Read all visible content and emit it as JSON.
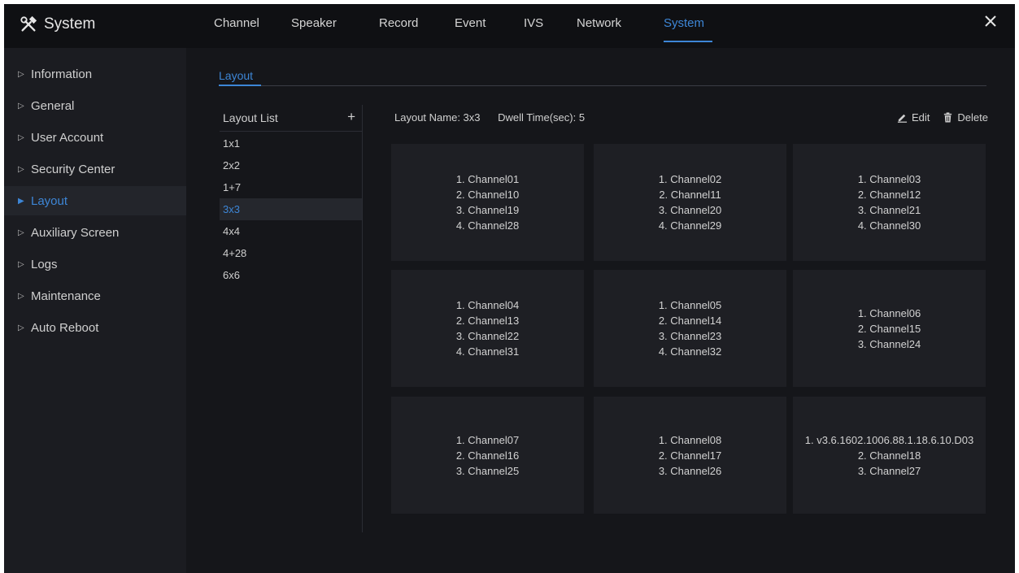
{
  "app": {
    "title": "System"
  },
  "top_tabs": [
    {
      "label": "Channel"
    },
    {
      "label": "Speaker"
    },
    {
      "label": "Record"
    },
    {
      "label": "Event"
    },
    {
      "label": "IVS"
    },
    {
      "label": "Network"
    },
    {
      "label": "System"
    }
  ],
  "active_tab": "System",
  "sidebar": {
    "items": [
      {
        "label": "Information"
      },
      {
        "label": "General"
      },
      {
        "label": "User Account"
      },
      {
        "label": "Security Center"
      },
      {
        "label": "Layout"
      },
      {
        "label": "Auxiliary Screen"
      },
      {
        "label": "Logs"
      },
      {
        "label": "Maintenance"
      },
      {
        "label": "Auto Reboot"
      }
    ],
    "active": "Layout"
  },
  "subtab": {
    "label": "Layout"
  },
  "layout_list": {
    "header": "Layout List",
    "add_label": "+",
    "items": [
      {
        "label": "1x1"
      },
      {
        "label": "2x2"
      },
      {
        "label": "1+7"
      },
      {
        "label": "3x3"
      },
      {
        "label": "4x4"
      },
      {
        "label": "4+28"
      },
      {
        "label": "6x6"
      }
    ],
    "selected": "3x3"
  },
  "detail": {
    "layout_name": "Layout Name: 3x3",
    "dwell_time": "Dwell Time(sec): 5",
    "edit_label": "Edit",
    "delete_label": "Delete"
  },
  "cells": [
    {
      "lines": [
        "1. Channel01",
        "2. Channel10",
        "3. Channel19",
        "4. Channel28"
      ]
    },
    {
      "lines": [
        "1. Channel02",
        "2. Channel11",
        "3. Channel20",
        "4. Channel29"
      ]
    },
    {
      "lines": [
        "1. Channel03",
        "2. Channel12",
        "3. Channel21",
        "4. Channel30"
      ]
    },
    {
      "lines": [
        "1. Channel04",
        "2. Channel13",
        "3. Channel22",
        "4. Channel31"
      ]
    },
    {
      "lines": [
        "1. Channel05",
        "2. Channel14",
        "3. Channel23",
        "4. Channel32"
      ]
    },
    {
      "lines": [
        "1. Channel06",
        "2. Channel15",
        "3. Channel24"
      ]
    },
    {
      "lines": [
        "1. Channel07",
        "2. Channel16",
        "3. Channel25"
      ]
    },
    {
      "lines": [
        "1. Channel08",
        "2. Channel17",
        "3. Channel26"
      ]
    },
    {
      "lines": [
        "1. v3.6.1602.1006.88.1.18.6.10.D03",
        "2. Channel18",
        "3. Channel27"
      ]
    }
  ],
  "colors": {
    "accent": "#3d86d6",
    "background": "#15161a",
    "sidebar": "#1b1c21",
    "cell": "#1e1f24"
  },
  "icons": {
    "brand": "tools-icon",
    "close": "close-icon",
    "edit": "pencil-icon",
    "delete": "trash-icon",
    "add": "plus-icon"
  }
}
